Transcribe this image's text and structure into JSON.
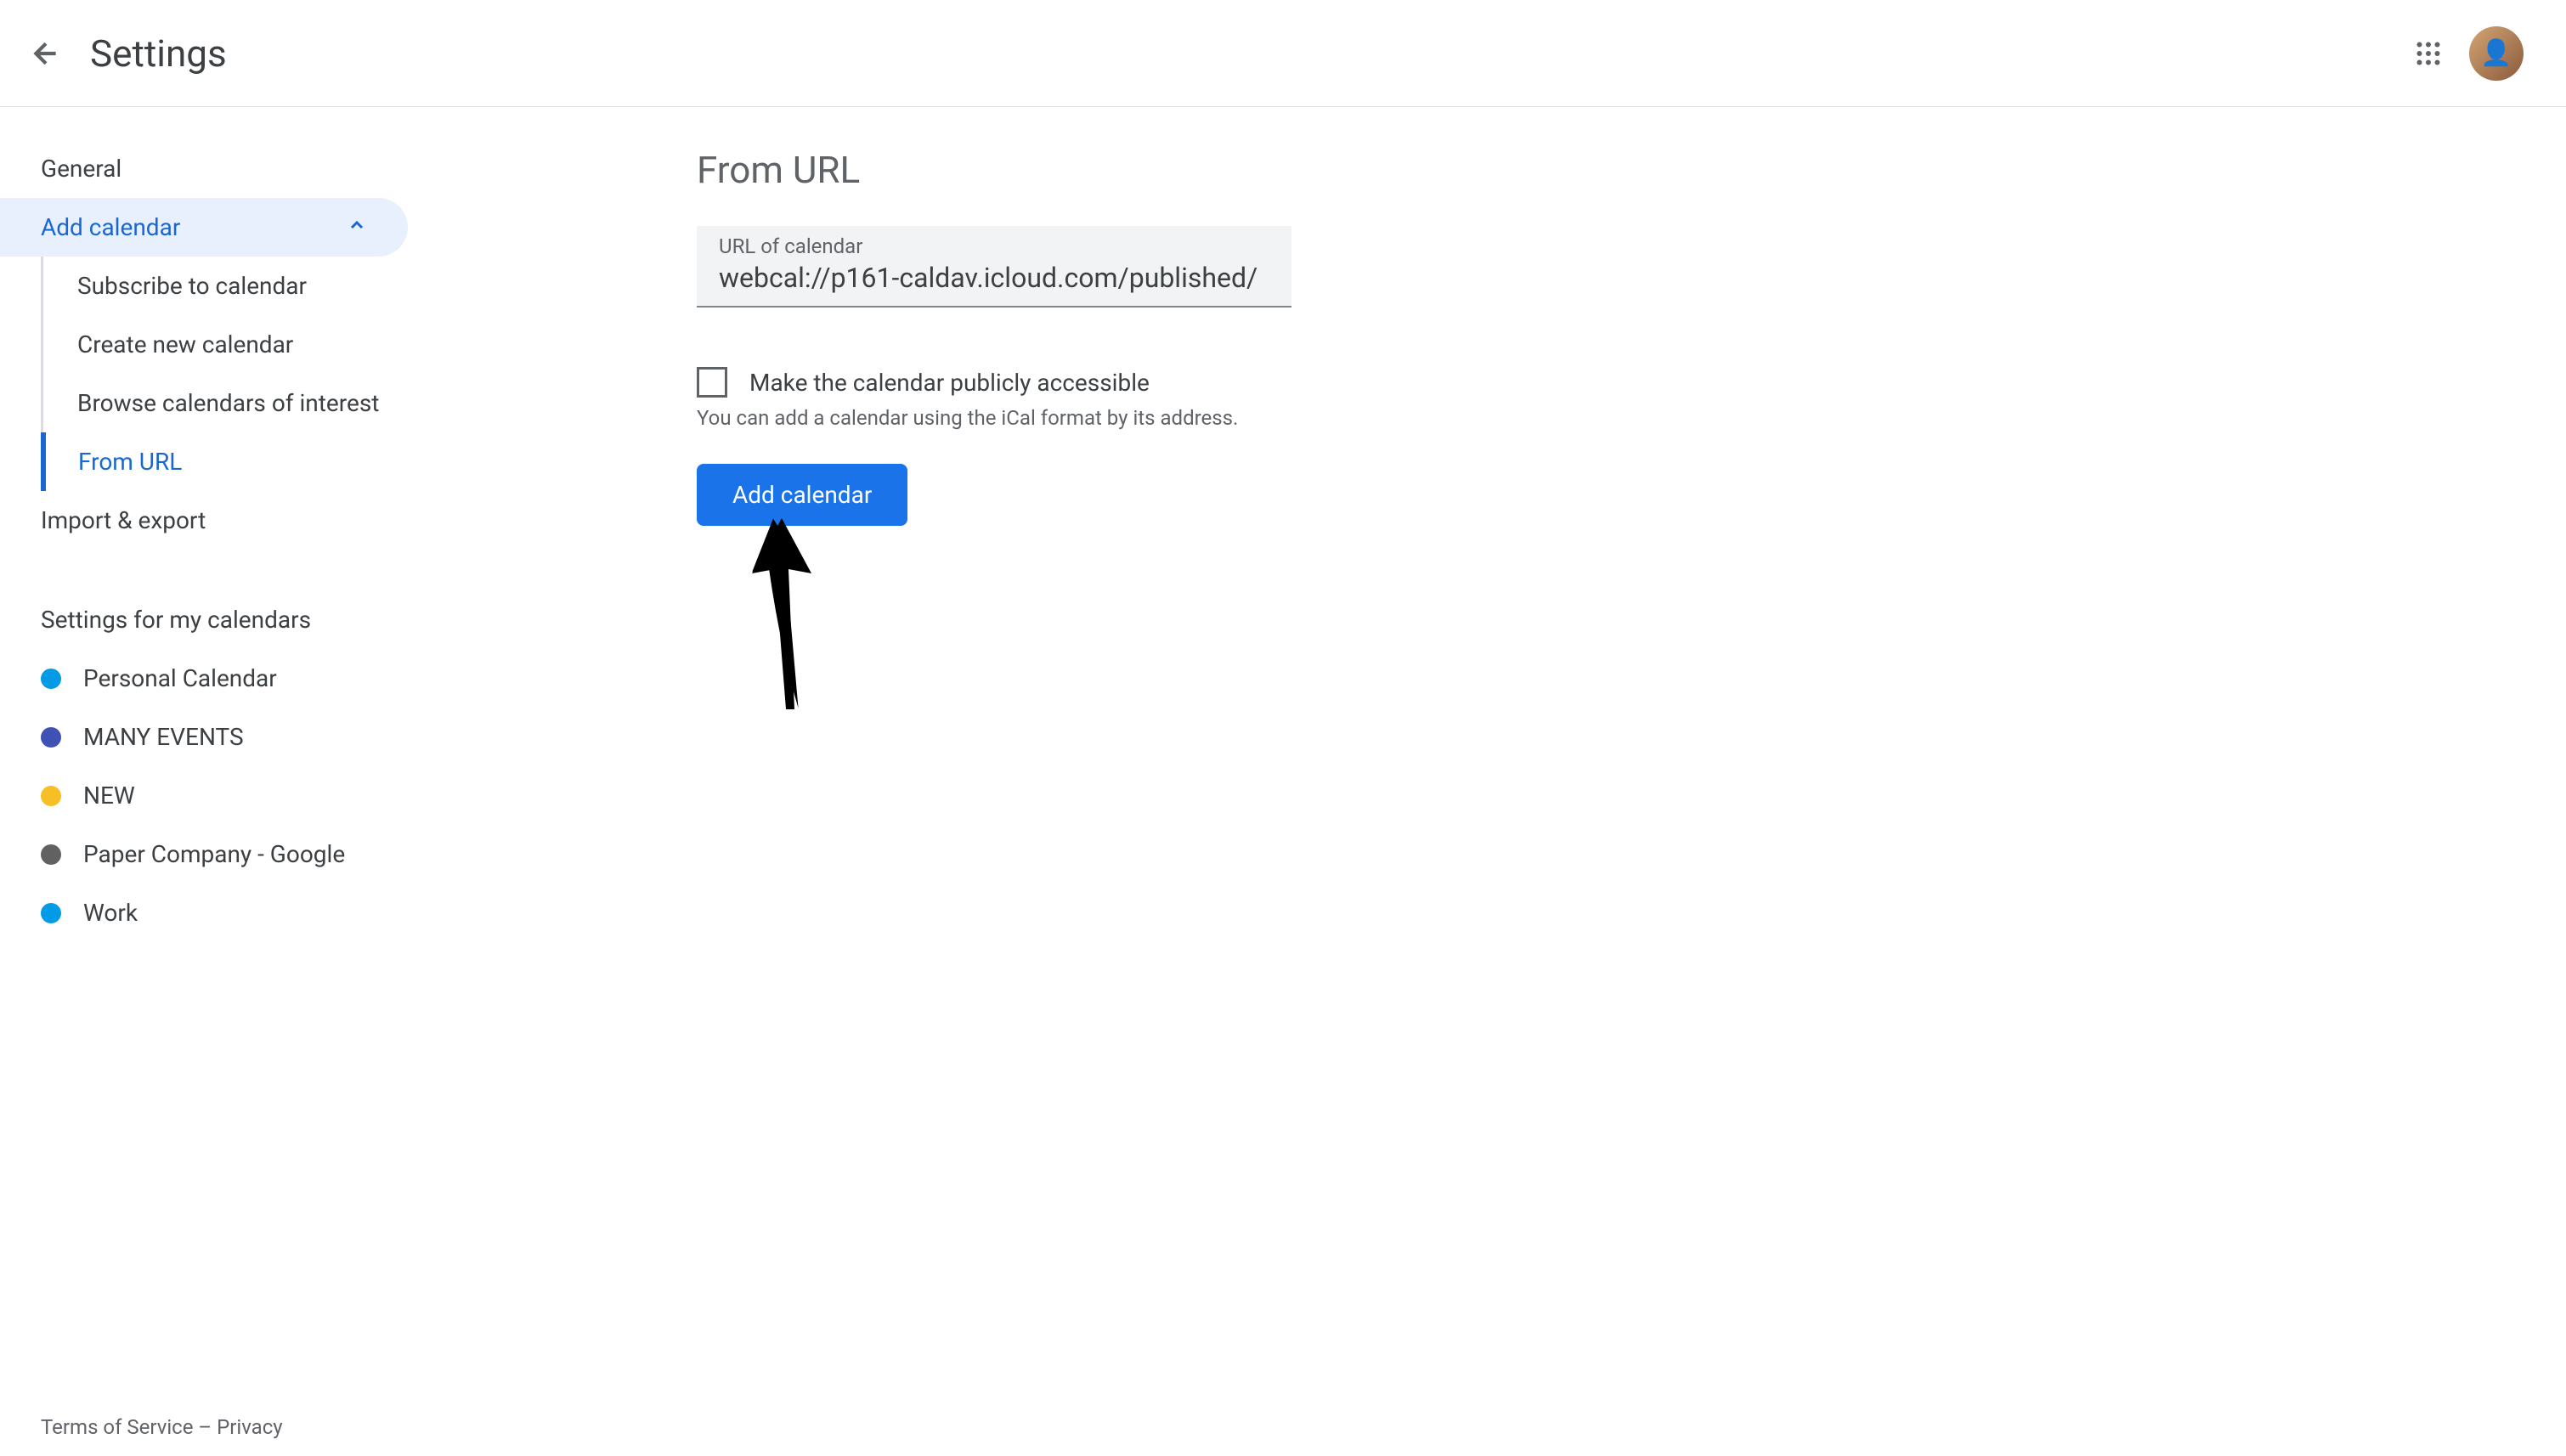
{
  "header": {
    "title": "Settings"
  },
  "sidebar": {
    "general": "General",
    "add_calendar": "Add calendar",
    "subscribe": "Subscribe to calendar",
    "create_new": "Create new calendar",
    "browse": "Browse calendars of interest",
    "from_url": "From URL",
    "import_export": "Import & export",
    "section_title": "Settings for my calendars",
    "calendars": [
      {
        "name": "Personal Calendar",
        "color": "#039be5"
      },
      {
        "name": "MANY EVENTS",
        "color": "#3f51b5"
      },
      {
        "name": "NEW",
        "color": "#f6bf26"
      },
      {
        "name": "Paper Company - Google",
        "color": "#616161"
      },
      {
        "name": "Work",
        "color": "#039be5"
      }
    ]
  },
  "content": {
    "title": "From URL",
    "url_label": "URL of calendar",
    "url_value": "webcal://p161-caldav.icloud.com/published/",
    "checkbox_label": "Make the calendar publicly accessible",
    "help_text": "You can add a calendar using the iCal format by its address.",
    "button_label": "Add calendar"
  },
  "footer": {
    "terms": "Terms of Service",
    "separator": " – ",
    "privacy": "Privacy"
  }
}
